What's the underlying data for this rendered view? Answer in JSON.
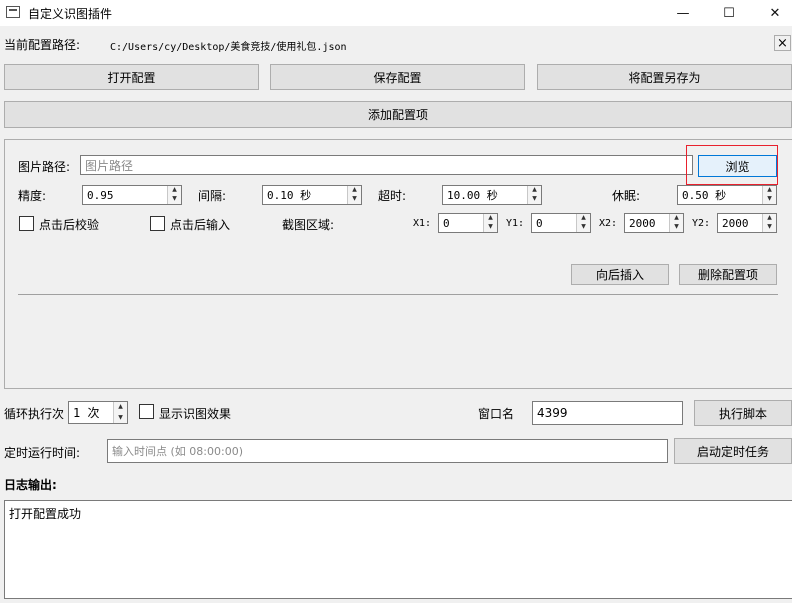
{
  "window": {
    "title": "自定义识图插件",
    "minimize_glyph": "—",
    "maximize_glyph": "☐",
    "close_glyph": "✕"
  },
  "config_path": {
    "label": "当前配置路径:",
    "value": "C:/Users/cy/Desktop/美食竞技/使用礼包.json",
    "clear_glyph": "×"
  },
  "toolbar": {
    "open_label": "打开配置",
    "save_label": "保存配置",
    "save_as_label": "将配置另存为",
    "add_item_label": "添加配置项"
  },
  "item": {
    "image_path_label": "图片路径:",
    "image_path_placeholder": "图片路径",
    "browse_label": "浏览",
    "precision_label": "精度:",
    "precision_value": "0.95",
    "interval_label": "间隔:",
    "interval_value": "0.10 秒",
    "timeout_label": "超时:",
    "timeout_value": "10.00 秒",
    "sleep_label": "休眠:",
    "sleep_value": "0.50 秒",
    "verify_after_click_label": "点击后校验",
    "input_after_click_label": "点击后输入",
    "capture_region_label": "截图区域:",
    "x1_label": "X1:",
    "x1_value": "0",
    "y1_label": "Y1:",
    "y1_value": "0",
    "x2_label": "X2:",
    "x2_value": "2000",
    "y2_label": "Y2:",
    "y2_value": "2000",
    "insert_after_label": "向后插入",
    "delete_item_label": "删除配置项"
  },
  "run": {
    "loop_label": "循环执行次",
    "loop_value": "1 次",
    "show_result_label": "显示识图效果",
    "window_name_label": "窗口名",
    "window_name_value": "4399",
    "execute_label": "执行脚本"
  },
  "schedule": {
    "label": "定时运行时间:",
    "placeholder": "输入时间点 (如 08:00:00)",
    "start_label": "启动定时任务"
  },
  "log": {
    "label": "日志输出:",
    "content": "打开配置成功"
  },
  "colors": {
    "highlight": "#e8212d",
    "background": "#f0f0f0",
    "button": "#e1e1e1"
  }
}
